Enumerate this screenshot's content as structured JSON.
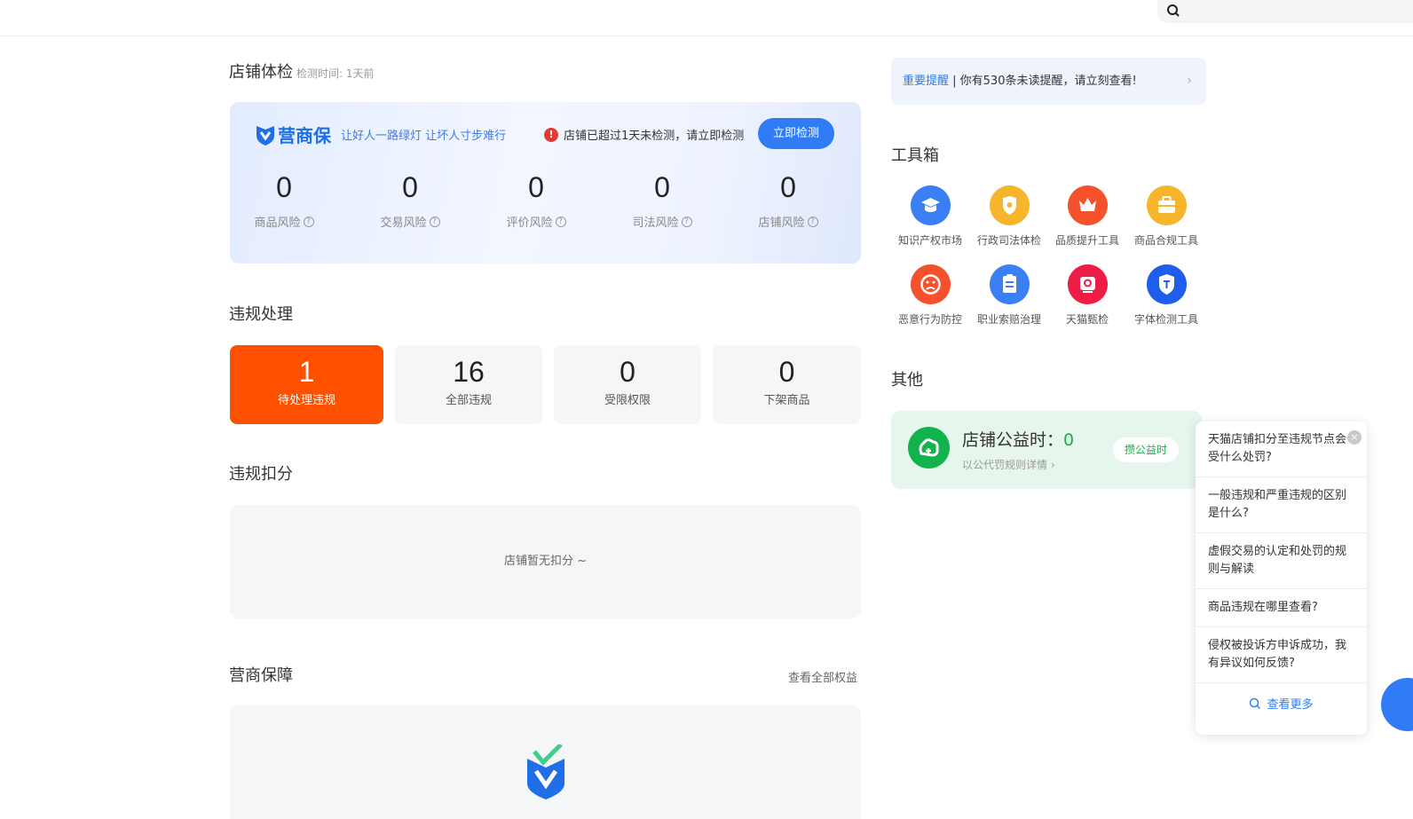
{
  "colors": {
    "accent": "#2f7cf6",
    "danger": "#ff5000",
    "success": "#12b24c"
  },
  "header": {
    "search_icon": "search-icon"
  },
  "health": {
    "title": "店铺体检",
    "check_time": "检测时间: 1天前",
    "brand_name": "营商保",
    "slogan": "让好人一路绿灯 让坏人寸步难行",
    "warning": "店铺已超过1天未检测，请立即检测",
    "check_button": "立即检测",
    "risks": [
      {
        "value": "0",
        "label": "商品风险"
      },
      {
        "value": "0",
        "label": "交易风险"
      },
      {
        "value": "0",
        "label": "评价风险"
      },
      {
        "value": "0",
        "label": "司法风险"
      },
      {
        "value": "0",
        "label": "店铺风险"
      }
    ]
  },
  "violation": {
    "title": "违规处理",
    "boxes": [
      {
        "value": "1",
        "label": "待处理违规"
      },
      {
        "value": "16",
        "label": "全部违规"
      },
      {
        "value": "0",
        "label": "受限权限"
      },
      {
        "value": "0",
        "label": "下架商品"
      }
    ]
  },
  "deduction": {
    "title": "违规扣分",
    "empty_text": "店铺暂无扣分 ~"
  },
  "guarantee": {
    "title": "营商保障",
    "view_all": "查看全部权益"
  },
  "notice": {
    "highlight": "重要提醒",
    "text": " | 你有530条未读提醒，请立刻查看!",
    "arrow": "›"
  },
  "toolbox": {
    "title": "工具箱",
    "tools": [
      {
        "label": "知识产权市场",
        "icon": "graduation-cap-icon",
        "color": "#3b7ff5"
      },
      {
        "label": "行政司法体检",
        "icon": "shield-badge-icon",
        "color": "#f7b52b"
      },
      {
        "label": "品质提升工具",
        "icon": "crown-icon",
        "color": "#f5512c"
      },
      {
        "label": "商品合规工具",
        "icon": "briefcase-icon",
        "color": "#f7b52b"
      },
      {
        "label": "恶意行为防控",
        "icon": "sad-face-icon",
        "color": "#f5512c"
      },
      {
        "label": "职业索赔治理",
        "icon": "claim-document-icon",
        "color": "#3b7ff5"
      },
      {
        "label": "天猫甄检",
        "icon": "inspection-icon",
        "color": "#ee1d45"
      },
      {
        "label": "字体检测工具",
        "icon": "font-shield-icon",
        "color": "#1e5eea"
      }
    ]
  },
  "other": {
    "title": "其他",
    "welfare_title": "店铺公益时：",
    "welfare_value": "0",
    "welfare_sub": "以公代罚规则详情 ›",
    "welfare_button": "攒公益时"
  },
  "faq": {
    "close": "×",
    "items": [
      "天猫店铺扣分至违规节点会受什么处罚?",
      "一般违规和严重违规的区别是什么?",
      "虚假交易的认定和处罚的规则与解读",
      "商品违规在哪里查看?",
      "侵权被投诉方申诉成功，我有异议如何反馈?"
    ],
    "more": "查看更多"
  }
}
